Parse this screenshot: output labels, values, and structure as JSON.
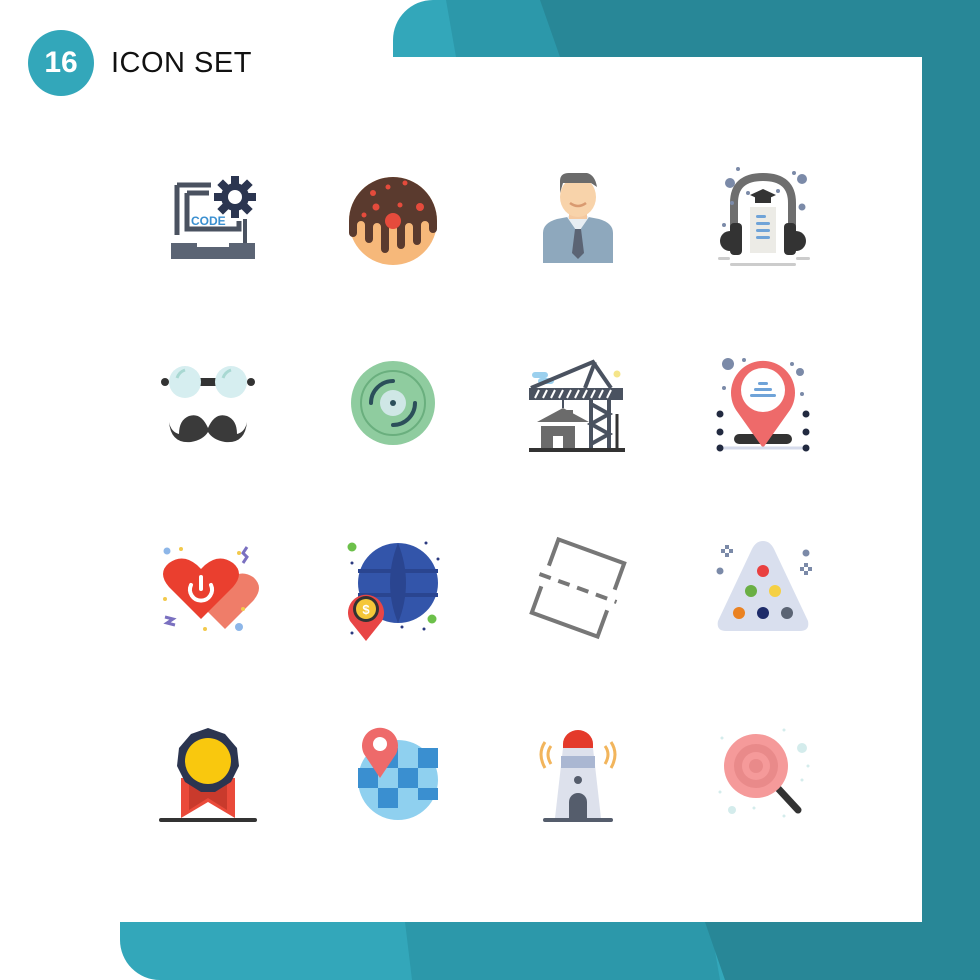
{
  "header": {
    "badge_number": "16",
    "title": "ICON SET"
  },
  "colors": {
    "accent": "#33a7ba",
    "band_mid": "#2c98aa",
    "band_dark": "#288797",
    "background": "#ffffff"
  },
  "icons": [
    {
      "name": "code-settings-laptop-icon"
    },
    {
      "name": "donut-icon",
      "text": ""
    },
    {
      "name": "businessman-icon"
    },
    {
      "name": "education-headphones-icon"
    },
    {
      "name": "glasses-mustache-icon"
    },
    {
      "name": "vinyl-disc-icon"
    },
    {
      "name": "construction-crane-icon"
    },
    {
      "name": "location-pin-icon"
    },
    {
      "name": "heart-power-icon"
    },
    {
      "name": "globe-dollar-pin-icon"
    },
    {
      "name": "crop-cut-icon"
    },
    {
      "name": "billiard-triangle-icon"
    },
    {
      "name": "award-badge-icon"
    },
    {
      "name": "globe-location-icon"
    },
    {
      "name": "lighthouse-icon"
    },
    {
      "name": "lollipop-search-icon"
    }
  ],
  "code_label": "CODE",
  "dollar_label": "$"
}
